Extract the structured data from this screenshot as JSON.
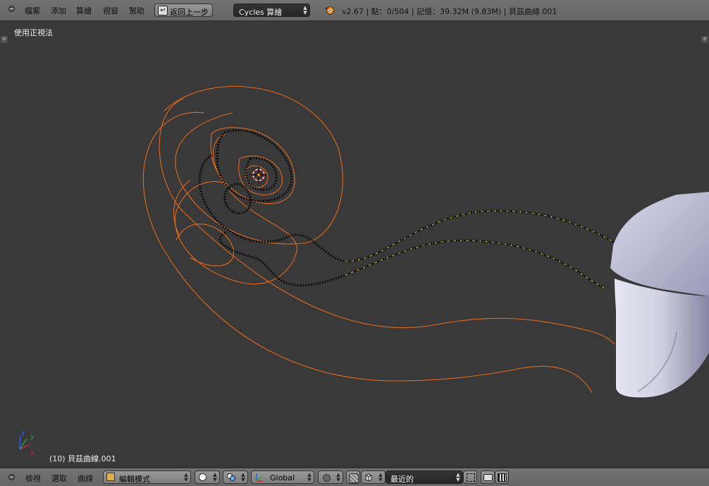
{
  "header": {
    "menus": [
      "檔案",
      "添加",
      "算繪",
      "視窗",
      "幫助"
    ],
    "back_label": "返回上一步",
    "render_engine": "Cycles 算繪",
    "stats": "v2.67 | 點：0/504 | 記憶：39.32M (9.83M) | 貝茲曲線.001"
  },
  "viewport": {
    "view_label": "使用正視法",
    "object_label": "(10) 貝茲曲線.001",
    "axis_labels": {
      "x": "x",
      "y": "y",
      "z": "z"
    }
  },
  "footer": {
    "menus": [
      "檢視",
      "選取",
      "曲線"
    ],
    "mode": "編輯模式",
    "orientation": "Global",
    "snap_target": "最近的"
  },
  "colors": {
    "viewport_bg": "#393939",
    "curve_orange": "#e2691a",
    "selected_points": "#d8d83a",
    "mesh_shade": "#c8c8e0"
  },
  "icons": [
    "collapse-icon",
    "back-icon",
    "blender-logo-icon",
    "mode-icon",
    "shading-icon",
    "pivot-icon",
    "manipulator-icon",
    "proportional-icon",
    "snap-icon",
    "magnet-icon",
    "render-icon",
    "camera-icon",
    "clapper-icon"
  ]
}
